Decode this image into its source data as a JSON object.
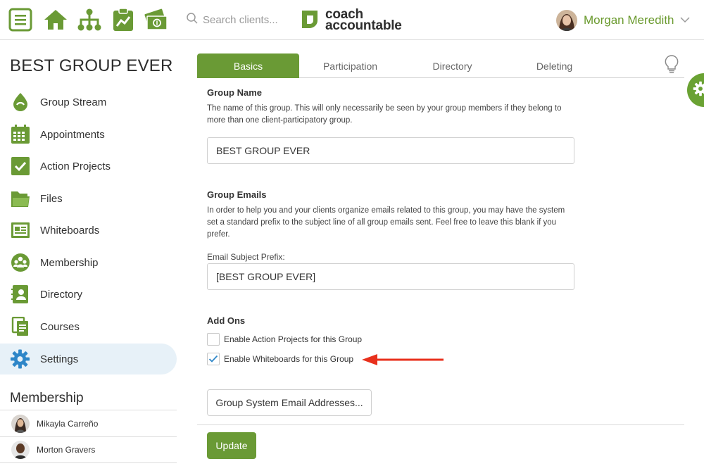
{
  "topbar": {
    "icons": [
      "menu-icon",
      "home-icon",
      "org-chart-icon",
      "clipboard-chart-icon",
      "money-icon"
    ],
    "search_placeholder": "Search clients...",
    "logo_line1": "coach",
    "logo_line2": "accountable",
    "user_name": "Morgan Meredith"
  },
  "sidebar": {
    "group_title": "BEST GROUP EVER",
    "items": [
      {
        "label": "Group Stream",
        "icon": "group-stream-icon"
      },
      {
        "label": "Appointments",
        "icon": "calendar-icon"
      },
      {
        "label": "Action Projects",
        "icon": "checkbox-icon"
      },
      {
        "label": "Files",
        "icon": "folder-icon"
      },
      {
        "label": "Whiteboards",
        "icon": "whiteboard-icon"
      },
      {
        "label": "Membership",
        "icon": "members-icon"
      },
      {
        "label": "Directory",
        "icon": "directory-icon"
      },
      {
        "label": "Courses",
        "icon": "courses-icon"
      },
      {
        "label": "Settings",
        "icon": "gear-icon"
      }
    ],
    "active_item": "Settings",
    "membership_title": "Membership",
    "members": [
      "Mikayla Carreño",
      "Morton Gravers"
    ]
  },
  "tabs": [
    "Basics",
    "Participation",
    "Directory",
    "Deleting"
  ],
  "active_tab": "Basics",
  "form": {
    "group_name": {
      "heading": "Group Name",
      "description": "The name of this group. This will only necessarily be seen by your group members if they belong to more than one client-participatory group.",
      "value": "BEST GROUP EVER"
    },
    "group_emails": {
      "heading": "Group Emails",
      "description": "In order to help you and your clients organize emails related to this group, you may have the system set a standard prefix to the subject line of all group emails sent. Feel free to leave this blank if you prefer.",
      "prefix_label": "Email Subject Prefix:",
      "prefix_value": "[BEST GROUP EVER]"
    },
    "add_ons": {
      "heading": "Add Ons",
      "options": [
        {
          "label": "Enable Action Projects for this Group",
          "checked": false
        },
        {
          "label": "Enable Whiteboards for this Group",
          "checked": true
        }
      ]
    },
    "system_email_button": "Group System Email Addresses...",
    "update_button": "Update"
  },
  "colors": {
    "brand_green": "#6a9a35",
    "active_nav_bg": "#e7f1f8",
    "annotation_arrow": "#e8301c"
  }
}
